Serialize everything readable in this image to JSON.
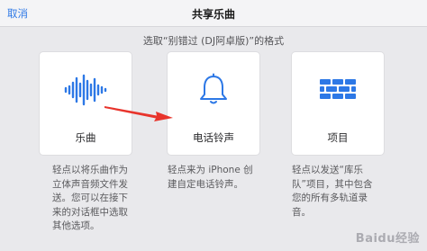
{
  "nav": {
    "cancel_label": "取消",
    "title": "共享乐曲"
  },
  "subtitle": "选取“别错过 (DJ阿卓版)”的格式",
  "options": [
    {
      "icon": "waveform-icon",
      "label": "乐曲",
      "description": [
        "轻点以将乐曲作为",
        "立体声音频文件发",
        "送。您可以在接下",
        "来的对话框中选取",
        "其他选项。"
      ]
    },
    {
      "icon": "bell-icon",
      "label": "电话铃声",
      "description": [
        "轻点来为 iPhone 创",
        "建自定电话铃声。"
      ]
    },
    {
      "icon": "brick-wall-icon",
      "label": "项目",
      "description": [
        "轻点以发送“库乐",
        "队”项目，其中包含",
        "您的所有多轨道录",
        "音。"
      ]
    }
  ],
  "colors": {
    "accent": "#2d78e6",
    "arrow": "#e8342c"
  },
  "watermark": "Baidu经验"
}
